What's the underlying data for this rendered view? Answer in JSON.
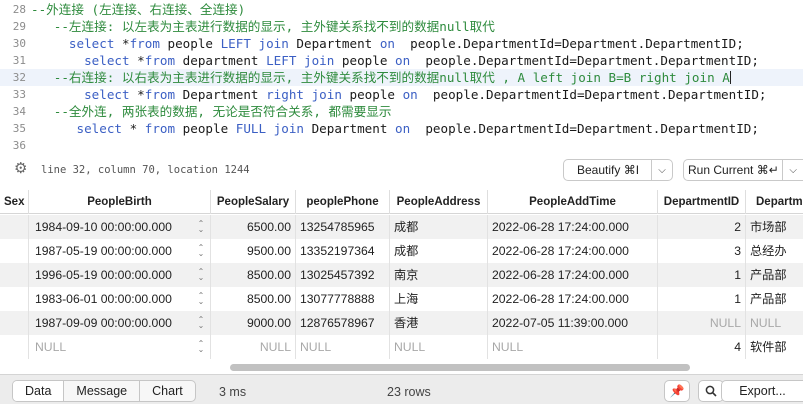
{
  "editor": {
    "lines": [
      {
        "num": "28",
        "parts": [
          {
            "t": "cm",
            "s": "--外连接 (左连接、右连接、全连接)"
          }
        ]
      },
      {
        "num": "29",
        "parts": [
          {
            "t": "cm",
            "s": "   --左连接: 以左表为主表进行数据的显示, 主外键关系找不到的数据null取代"
          }
        ]
      },
      {
        "num": "30",
        "parts": [
          {
            "t": "kw",
            "s": "     select "
          },
          {
            "t": "tx",
            "s": "*"
          },
          {
            "t": "kw",
            "s": "from "
          },
          {
            "t": "tx",
            "s": "people "
          },
          {
            "t": "kw",
            "s": "LEFT join "
          },
          {
            "t": "tx",
            "s": "Department "
          },
          {
            "t": "kw",
            "s": "on  "
          },
          {
            "t": "tx",
            "s": "people.DepartmentId=Department.DepartmentID;"
          }
        ]
      },
      {
        "num": "31",
        "parts": [
          {
            "t": "kw",
            "s": "       select "
          },
          {
            "t": "tx",
            "s": "*"
          },
          {
            "t": "kw",
            "s": "from "
          },
          {
            "t": "tx",
            "s": "department "
          },
          {
            "t": "kw",
            "s": "LEFT join "
          },
          {
            "t": "tx",
            "s": "people "
          },
          {
            "t": "kw",
            "s": "on  "
          },
          {
            "t": "tx",
            "s": "people.DepartmentId=Department.DepartmentID;"
          }
        ]
      },
      {
        "num": "32",
        "active": true,
        "parts": [
          {
            "t": "cm",
            "s": "   --右连接: 以右表为主表进行数据的显示, 主外键关系找不到的数据null取代 , A left join B=B right join A"
          }
        ],
        "caret": true
      },
      {
        "num": "33",
        "parts": [
          {
            "t": "kw",
            "s": "       select "
          },
          {
            "t": "tx",
            "s": "*"
          },
          {
            "t": "kw",
            "s": "from "
          },
          {
            "t": "tx",
            "s": "Department "
          },
          {
            "t": "kw",
            "s": "right join "
          },
          {
            "t": "tx",
            "s": "people "
          },
          {
            "t": "kw",
            "s": "on  "
          },
          {
            "t": "tx",
            "s": "people.DepartmentId=Department.DepartmentID;"
          }
        ]
      },
      {
        "num": "34",
        "parts": [
          {
            "t": "cm",
            "s": "   --全外连, 两张表的数据, 无论是否符合关系, 都需要显示"
          }
        ]
      },
      {
        "num": "35",
        "parts": [
          {
            "t": "kw",
            "s": "      select "
          },
          {
            "t": "tx",
            "s": "* "
          },
          {
            "t": "kw",
            "s": "from "
          },
          {
            "t": "tx",
            "s": "people "
          },
          {
            "t": "kw",
            "s": "FULL join "
          },
          {
            "t": "tx",
            "s": "Department "
          },
          {
            "t": "kw",
            "s": "on  "
          },
          {
            "t": "tx",
            "s": "people.DepartmentId=Department.DepartmentID;"
          }
        ]
      },
      {
        "num": "36",
        "parts": []
      }
    ]
  },
  "statusbar": {
    "position_info": "line 32, column 70, location 1244",
    "gear_icon": "gear-icon",
    "beautify_label": "Beautify ⌘I",
    "run_current_label": "Run Current ⌘↵"
  },
  "grid": {
    "columns": [
      "Sex",
      "PeopleBirth",
      "PeopleSalary",
      "peoplePhone",
      "PeopleAddress",
      "PeopleAddTime",
      "DepartmentID",
      "DepartmentName"
    ],
    "column_visible_labels": [
      "Sex",
      "PeopleBirth",
      "PeopleSalary",
      "peoplePhone",
      "PeopleAddress",
      "PeopleAddTime",
      "DepartmentID",
      "Departm"
    ],
    "rows": [
      {
        "birth": "1984-09-10 00:00:00.000",
        "salary": "6500.00",
        "phone": "13254785965",
        "address": "成都",
        "added": "2022-06-28 17:24:00.000",
        "dept_id": "2",
        "dept_name": "市场部"
      },
      {
        "birth": "1987-05-19 00:00:00.000",
        "salary": "9500.00",
        "phone": "13352197364",
        "address": "成都",
        "added": "2022-06-28 17:24:00.000",
        "dept_id": "3",
        "dept_name": "总经办"
      },
      {
        "birth": "1996-05-19 00:00:00.000",
        "salary": "8500.00",
        "phone": "13025457392",
        "address": "南京",
        "added": "2022-06-28 17:24:00.000",
        "dept_id": "1",
        "dept_name": "产品部"
      },
      {
        "birth": "1983-06-01 00:00:00.000",
        "salary": "8500.00",
        "phone": "13077778888",
        "address": "上海",
        "added": "2022-06-28 17:24:00.000",
        "dept_id": "1",
        "dept_name": "产品部"
      },
      {
        "birth": "1987-09-09 00:00:00.000",
        "salary": "9000.00",
        "phone": "12876578967",
        "address": "香港",
        "added": "2022-07-05 11:39:00.000",
        "dept_id": "NULL",
        "dept_name": "NULL"
      },
      {
        "birth": "NULL",
        "salary": "NULL",
        "phone": "NULL",
        "address": "NULL",
        "added": "NULL",
        "dept_id": "4",
        "dept_name": "软件部"
      }
    ]
  },
  "bottombar": {
    "tabs": [
      "Data",
      "Message",
      "Chart"
    ],
    "active_tab": "Data",
    "elapsed": "3 ms",
    "row_count": "23 rows",
    "pin_icon": "pin-icon",
    "search_icon": "search-icon",
    "export_label": "Export..."
  },
  "colors": {
    "comment": "#2e8b3d",
    "keyword": "#3b5fc4",
    "pin": "#d23b2a"
  }
}
